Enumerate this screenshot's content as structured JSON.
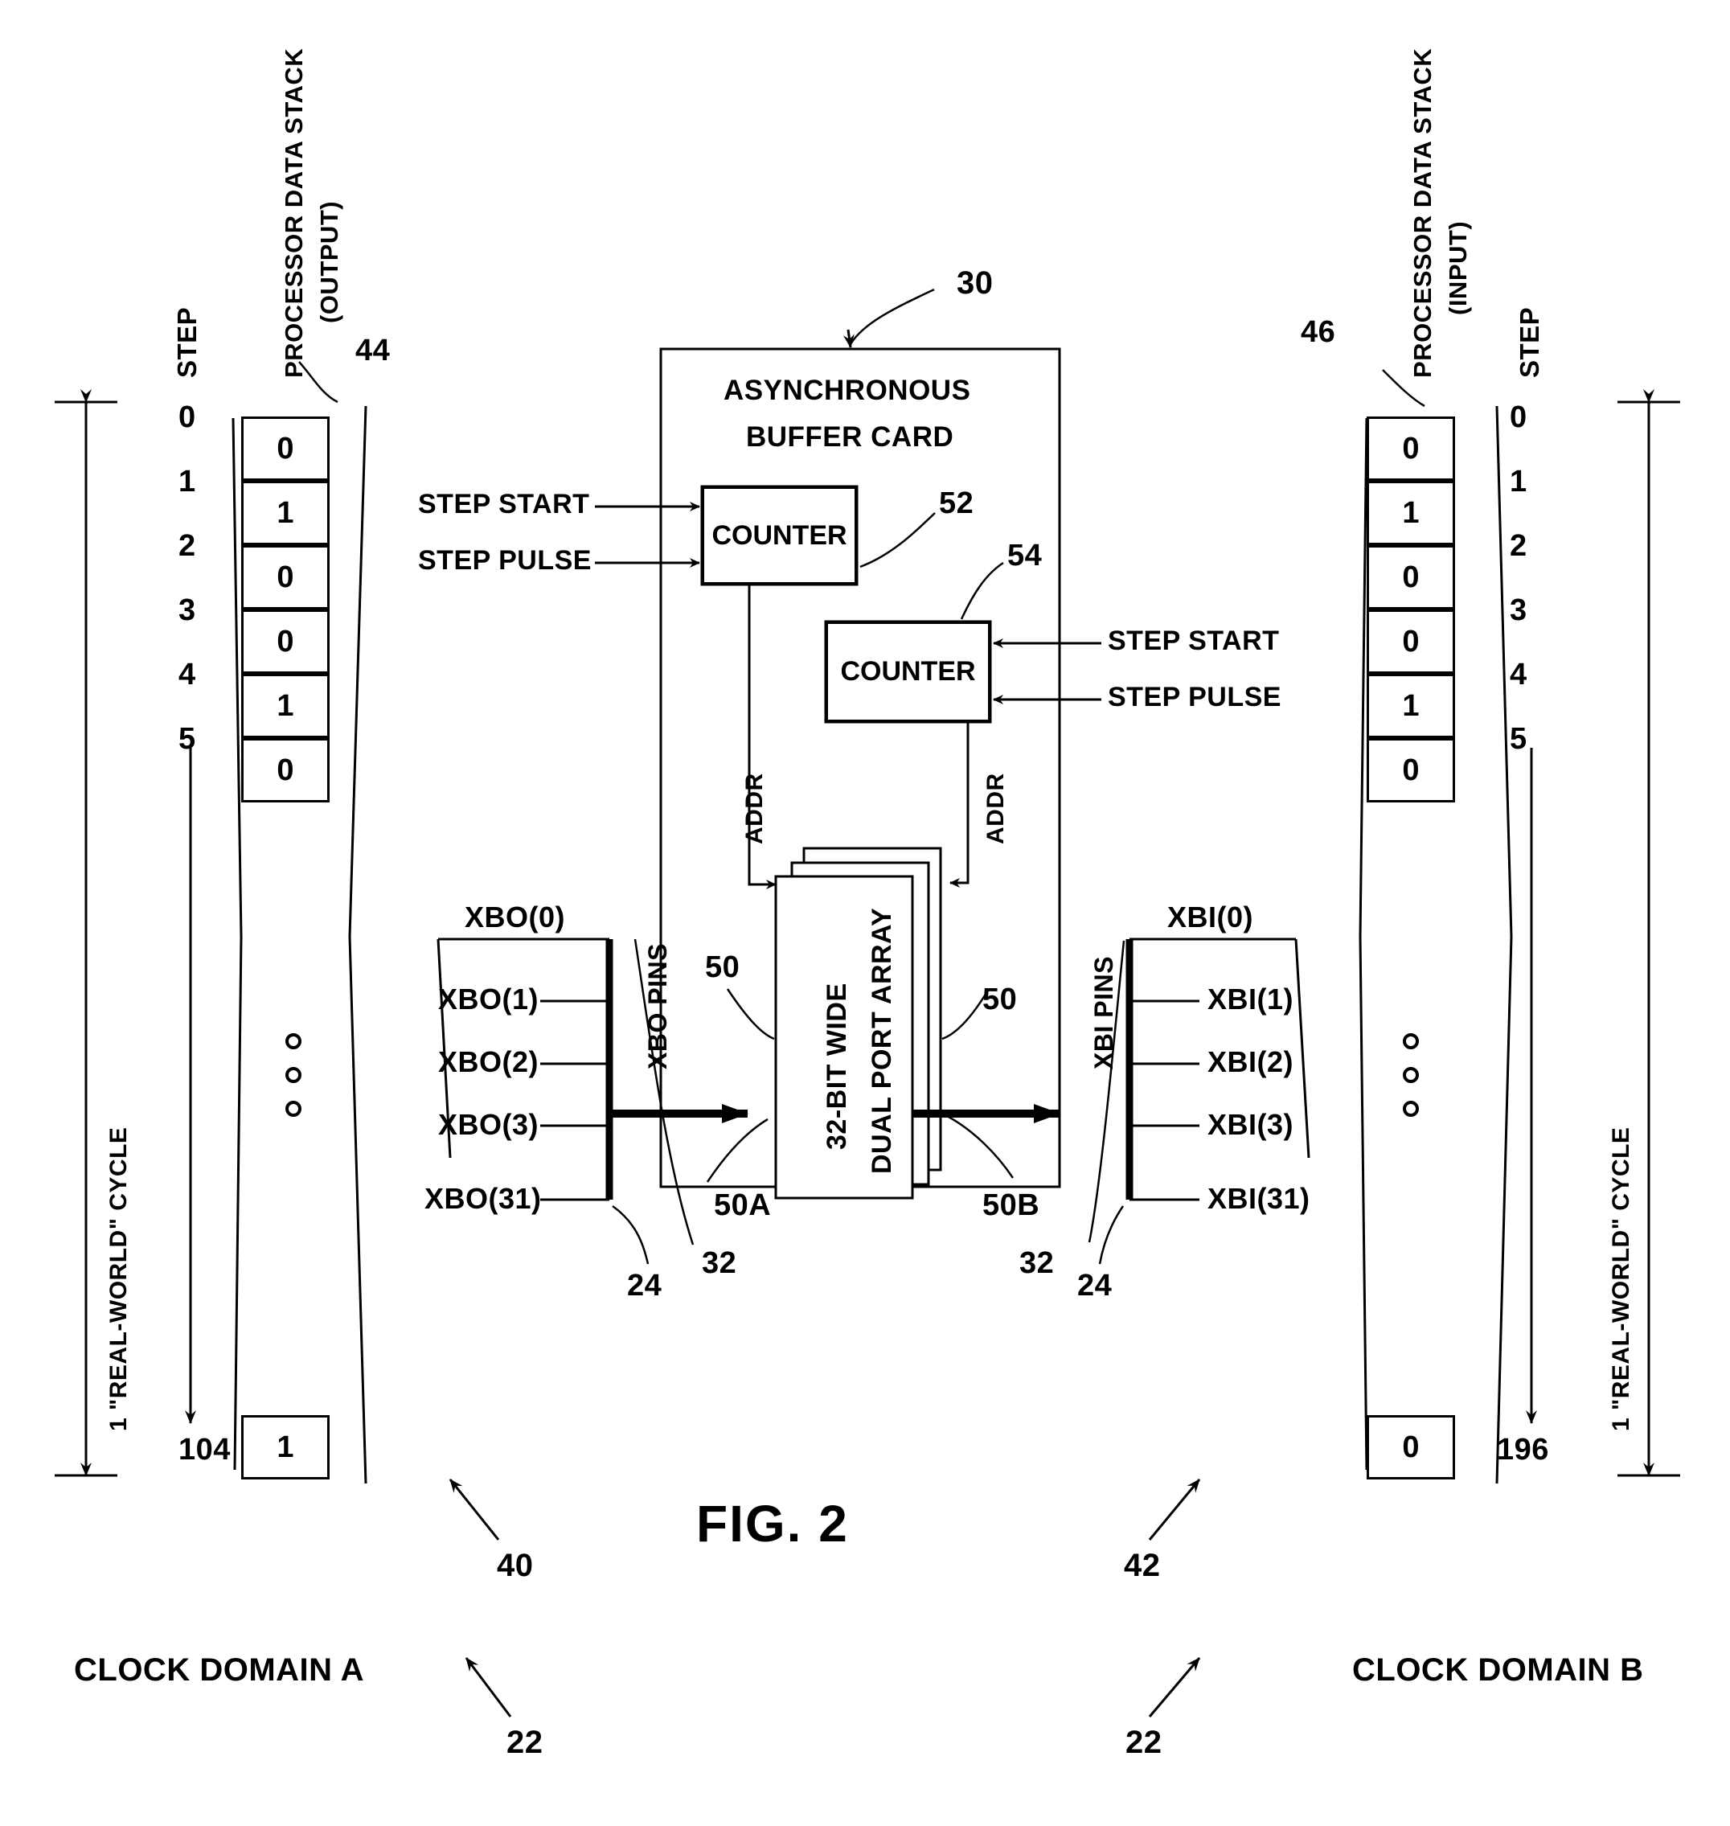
{
  "figure": {
    "label": "FIG. 2"
  },
  "left_domain": {
    "domain_label": "CLOCK DOMAIN A",
    "domain_ref": "22",
    "group_ref": "40",
    "stack_title_line1": "PROCESSOR DATA STACK",
    "stack_title_line2": "(OUTPUT)",
    "stack_ref": "44",
    "step_header": "STEP",
    "cycle_label": "1 \"REAL-WORLD\" CYCLE",
    "steps": [
      "0",
      "1",
      "2",
      "3",
      "4",
      "5"
    ],
    "values": [
      "0",
      "1",
      "0",
      "0",
      "1",
      "0"
    ],
    "last_step": "104",
    "last_value": "1",
    "ellipsis_count": 3,
    "pins_label": "XBO PINS",
    "pins_ref": "24",
    "bus_ref": "32",
    "signals_top": "XBO(0)",
    "signals": [
      "XBO(1)",
      "XBO(2)",
      "XBO(3)"
    ],
    "signal_last": "XBO(31)"
  },
  "right_domain": {
    "domain_label": "CLOCK DOMAIN B",
    "domain_ref": "22",
    "group_ref": "42",
    "stack_title_line1": "PROCESSOR DATA STACK",
    "stack_title_line2": "(INPUT)",
    "stack_ref": "46",
    "step_header": "STEP",
    "cycle_label": "1 \"REAL-WORLD\" CYCLE",
    "steps": [
      "0",
      "1",
      "2",
      "3",
      "4",
      "5"
    ],
    "values": [
      "0",
      "1",
      "0",
      "0",
      "1",
      "0"
    ],
    "last_step": "196",
    "last_value": "0",
    "ellipsis_count": 3,
    "pins_label": "XBI PINS",
    "pins_ref": "24",
    "bus_ref": "32",
    "signals_top": "XBI(0)",
    "signals": [
      "XBI(1)",
      "XBI(2)",
      "XBI(3)"
    ],
    "signal_last": "XBI(31)"
  },
  "buffer_card": {
    "title_line1": "ASYNCHRONOUS",
    "title_line2": "BUFFER CARD",
    "ref": "30",
    "counter_left": {
      "label": "COUNTER",
      "ref": "52"
    },
    "counter_right": {
      "label": "COUNTER",
      "ref": "54"
    },
    "inputs_left": [
      "STEP START",
      "STEP PULSE"
    ],
    "inputs_right": [
      "STEP START",
      "STEP PULSE"
    ],
    "addr_left": "ADDR",
    "addr_right": "ADDR",
    "array": {
      "line1": "32-BIT WIDE",
      "line2": "DUAL PORT ARRAY"
    },
    "array_ref_left": "50",
    "array_ref_right": "50",
    "port_in_ref": "50A",
    "port_out_ref": "50B"
  }
}
